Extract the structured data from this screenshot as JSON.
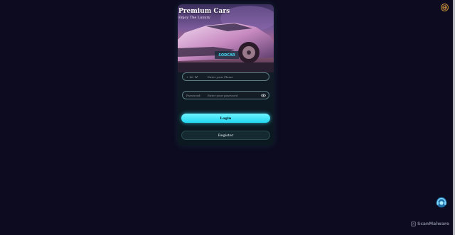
{
  "header": {
    "title": "Premium Cars",
    "subtitle": "Enjoy The Luxury"
  },
  "hero": {
    "plate_text": "SODCAR"
  },
  "form": {
    "phone": {
      "prefix": "+ 86",
      "placeholder": "Enter your Phone"
    },
    "password": {
      "label": "Password:",
      "placeholder": "Enter your password"
    },
    "login_label": "Login",
    "register_label": "Register"
  },
  "watermark": "ScanMalware",
  "icons": [
    "globe-icon",
    "eye-icon",
    "chevron-down-icon",
    "headset-icon"
  ],
  "colors": {
    "accent": "#22d7f0",
    "background": "#0d0b1f",
    "language_ring": "#c08a30"
  }
}
